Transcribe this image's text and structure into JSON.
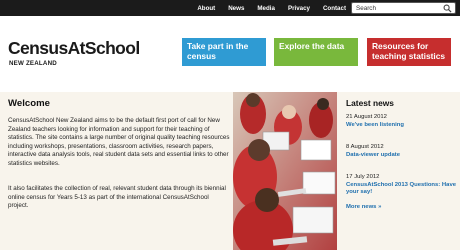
{
  "topnav": {
    "items": [
      {
        "label": "About"
      },
      {
        "label": "News"
      },
      {
        "label": "Media"
      },
      {
        "label": "Privacy"
      },
      {
        "label": "Contact"
      }
    ]
  },
  "search": {
    "text": "Search",
    "icon": "search-icon"
  },
  "logo": {
    "title": "CensusAtSchool",
    "subtitle": "NEW ZEALAND"
  },
  "header_buttons": [
    {
      "label": "Take part in the census",
      "color": "#2f9bd3"
    },
    {
      "label": "Explore the data",
      "color": "#79b83c"
    },
    {
      "label": "Resources for teaching statistics",
      "color": "#c62e2e"
    }
  ],
  "welcome": {
    "title": "Welcome",
    "p1": "CensusAtSchool New Zealand aims to be the default first port of call for New Zealand teachers looking for information and support for their teaching of statistics. The site contains a large number of original quality teaching resources including workshops, presentations, classroom activities, research papers, interactive data analysis tools, real student data sets and essential links to other statistics websites.",
    "p2": "It also facilitates the collection of real, relevant student data through its biennial online census for Years 5-13 as part of the international CensusAtSchool project."
  },
  "news": {
    "title": "Latest news",
    "items": [
      {
        "date": "21 August 2012",
        "headline": "We've been listening"
      },
      {
        "date": "8 August 2012",
        "headline": "Data-viewer update"
      },
      {
        "date": "17 July 2012",
        "headline": "CensusAtSchool 2013 Questions: Have your say!"
      }
    ],
    "more": "More news »"
  },
  "colors": {
    "topbar": "#1b1b1b",
    "link": "#1f6fae",
    "main_bg": "#f8f4ec"
  }
}
